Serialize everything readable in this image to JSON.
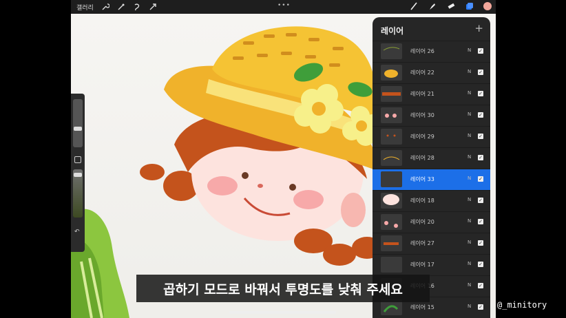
{
  "topbar": {
    "gallery_label": "갤러리",
    "left_icons": [
      "wrench-icon",
      "magic-wand-icon",
      "selection-icon",
      "transform-arrow-icon"
    ],
    "more_dots": "•••",
    "right_icons": [
      "brush-icon",
      "smudge-icon",
      "eraser-icon",
      "layers-icon"
    ],
    "active_color": "#f2a79b"
  },
  "sidebar": {
    "undo_glyph": "↶"
  },
  "layers_panel": {
    "title": "레이어",
    "add_glyph": "+",
    "layers": [
      {
        "name": "레이어 26",
        "blend": "N",
        "visible": true,
        "active": false
      },
      {
        "name": "레이어 22",
        "blend": "N",
        "visible": true,
        "active": false
      },
      {
        "name": "레이어 21",
        "blend": "N",
        "visible": true,
        "active": false
      },
      {
        "name": "레이어 30",
        "blend": "N",
        "visible": true,
        "active": false
      },
      {
        "name": "레이어 29",
        "blend": "N",
        "visible": true,
        "active": false
      },
      {
        "name": "레이어 28",
        "blend": "N",
        "visible": true,
        "active": false
      },
      {
        "name": "레이어 33",
        "blend": "N",
        "visible": true,
        "active": true
      },
      {
        "name": "레이어 18",
        "blend": "N",
        "visible": true,
        "active": false
      },
      {
        "name": "레이어 20",
        "blend": "N",
        "visible": true,
        "active": false
      },
      {
        "name": "레이어 27",
        "blend": "N",
        "visible": true,
        "active": false
      },
      {
        "name": "레이어 17",
        "blend": "N",
        "visible": true,
        "active": false
      },
      {
        "name": "레이어 16",
        "blend": "N",
        "visible": true,
        "active": false
      },
      {
        "name": "레이어 15",
        "blend": "N",
        "visible": true,
        "active": false
      }
    ],
    "check_glyph": "✓"
  },
  "subtitle": "곱하기 모드로 바꿔서 투명도를 낮춰 주세요",
  "watermark": "@_minitory"
}
